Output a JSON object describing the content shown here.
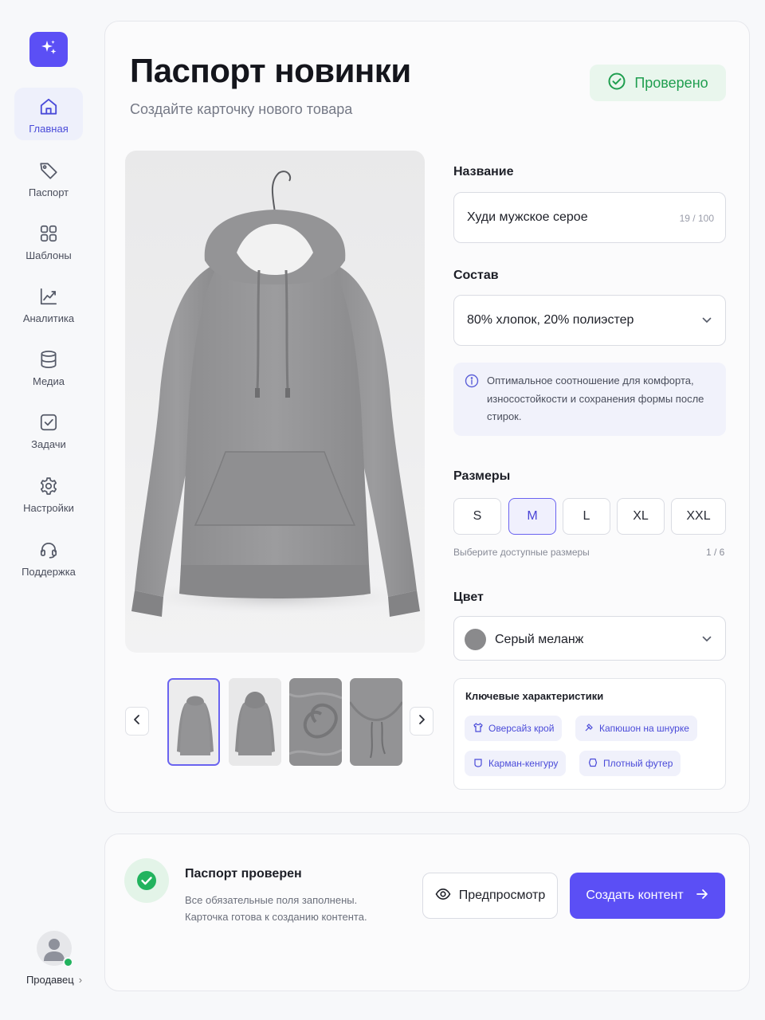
{
  "sidebar": {
    "logo_icon": "sparkles-icon",
    "items": [
      {
        "label": "Главная",
        "icon": "home-icon",
        "active": true
      },
      {
        "label": "Паспорт",
        "icon": "tag-icon"
      },
      {
        "label": "Шаблоны",
        "icon": "grid-icon"
      },
      {
        "label": "Аналитика",
        "icon": "chart-icon"
      },
      {
        "label": "Медиа",
        "icon": "database-icon"
      },
      {
        "label": "Задачи",
        "icon": "checkbox-icon"
      },
      {
        "label": "Настройки",
        "icon": "gear-icon"
      },
      {
        "label": "Поддержка",
        "icon": "headset-icon"
      }
    ],
    "seller": {
      "label": "Продавец",
      "status": "online"
    }
  },
  "header": {
    "title": "Паспорт новинки",
    "subtitle": "Создайте карточку нового товара",
    "badge": "Проверено"
  },
  "form": {
    "name": {
      "label": "Название",
      "value": "Худи мужское серое",
      "counter": "19 / 100"
    },
    "composition": {
      "label": "Состав",
      "value": "80% хлопок, 20% полиэстер",
      "info": "Оптимальное соотношение для комфорта, износостойкости и сохранения формы после стирок."
    },
    "sizes": {
      "label": "Размеры",
      "options": [
        "S",
        "M",
        "L",
        "XL",
        "XXL"
      ],
      "selected": "M",
      "hint": "Выберите доступные размеры",
      "count": "1 / 6"
    },
    "color": {
      "label": "Цвет",
      "value": "Серый меланж",
      "swatch": "#8a8a8c"
    },
    "features": {
      "title": "Ключевые характеристики",
      "chips": [
        "Оверсайз крой",
        "Капюшон на шнурке",
        "Карман-кенгуру",
        "Плотный футер"
      ]
    }
  },
  "gallery": {
    "thumbnail_count": 4,
    "active_index": 0
  },
  "footer": {
    "status_title": "Паспорт проверен",
    "status_line1": "Все обязательные поля заполнены.",
    "status_line2": "Карточка готова к созданию контента.",
    "preview_label": "Предпросмотр",
    "create_label": "Создать контент"
  },
  "colors": {
    "accent": "#5b4ff5",
    "success": "#1f9e4f"
  }
}
